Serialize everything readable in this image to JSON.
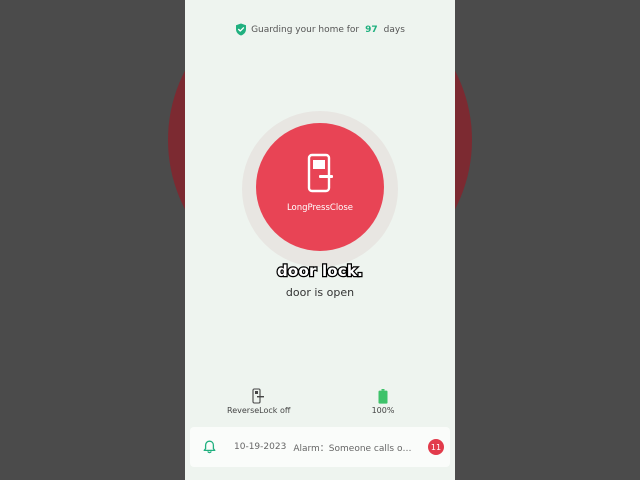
{
  "status": {
    "prefix": "Guarding your home for",
    "days": "97",
    "suffix": "days"
  },
  "main_button": {
    "label": "LongPressClose"
  },
  "overlay_caption": "door lock.",
  "door_status": "door is open",
  "reverse_lock": {
    "label": "ReverseLock off"
  },
  "battery": {
    "label": "100%",
    "level": 1.0
  },
  "alarm": {
    "date": "10-19-2023",
    "text": "Alarm：Someone calls out...",
    "badge": "11"
  },
  "colors": {
    "accent_green": "#20b07f",
    "button_red": "#e84455",
    "badge_red": "#e23b4b"
  }
}
